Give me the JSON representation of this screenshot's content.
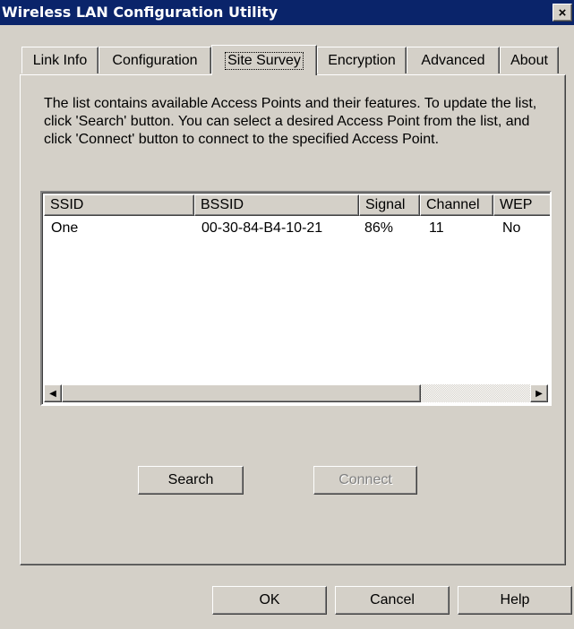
{
  "window": {
    "title": "Wireless LAN Configuration Utility",
    "close_glyph": "×"
  },
  "tabs": [
    {
      "label": "Link Info"
    },
    {
      "label": "Configuration"
    },
    {
      "label": "Site Survey",
      "active": true
    },
    {
      "label": "Encryption"
    },
    {
      "label": "Advanced"
    },
    {
      "label": "About"
    }
  ],
  "site_survey": {
    "description": "The list contains available Access Points and their features. To update the list, click 'Search' button. You can select a desired Access Point from the list, and click 'Connect' button to connect to the specified Access Point.",
    "columns": [
      "SSID",
      "BSSID",
      "Signal",
      "Channel",
      "WEP"
    ],
    "rows": [
      [
        "One",
        "00-30-84-B4-10-21",
        "86%",
        "11",
        "No"
      ]
    ],
    "search_label": "Search",
    "connect_label": "Connect",
    "connect_enabled": false
  },
  "footer": {
    "ok_label": "OK",
    "cancel_label": "Cancel",
    "help_label": "Help"
  },
  "icons": {
    "close": "close-icon",
    "scroll_left": "arrow-left-icon",
    "scroll_right": "arrow-right-icon"
  },
  "colors": {
    "titlebar": "#0a246a",
    "face": "#d4d0c8",
    "disabled_text": "#808080"
  }
}
